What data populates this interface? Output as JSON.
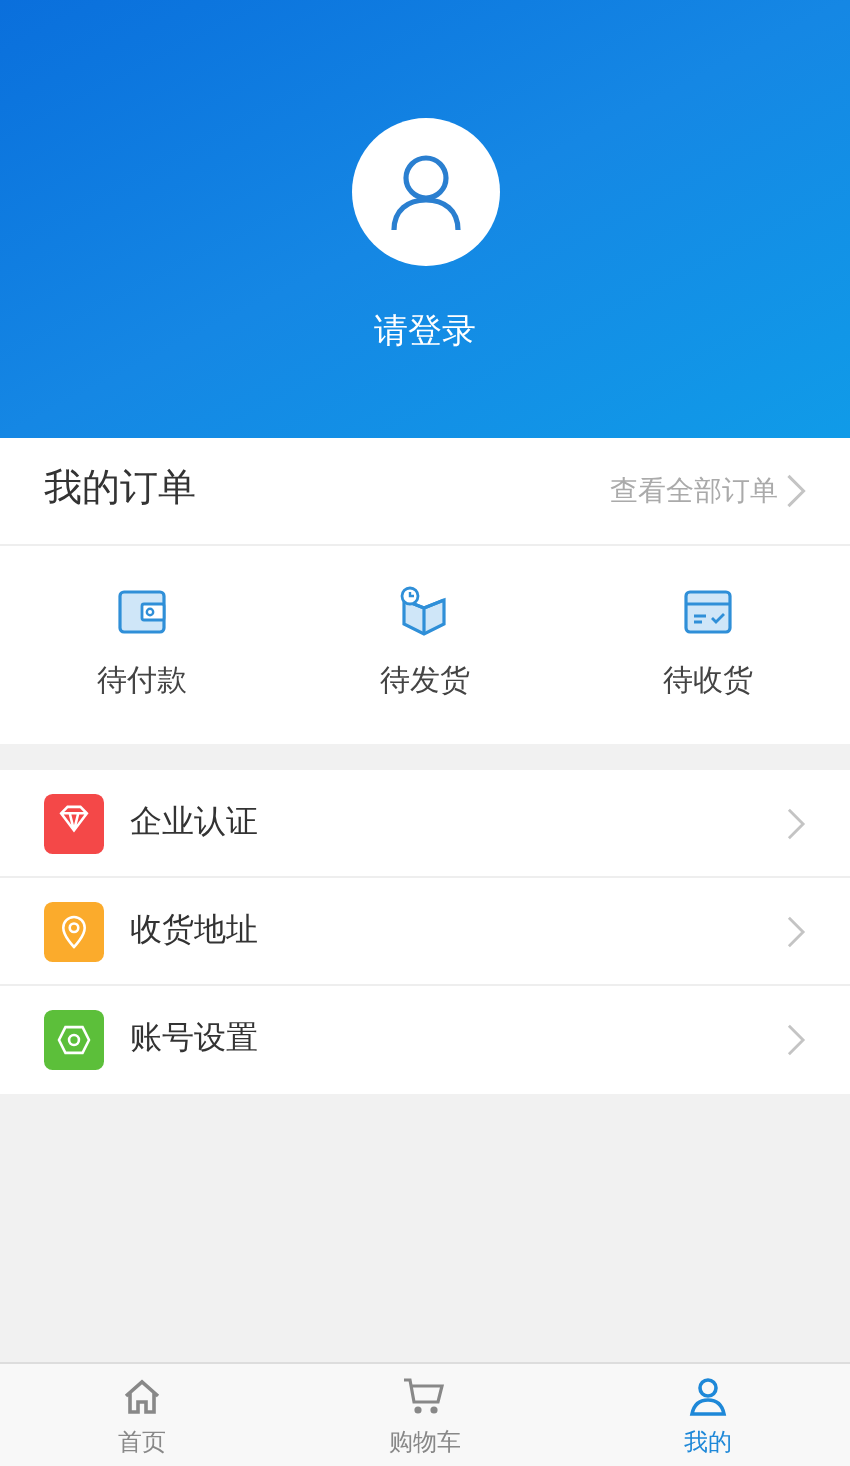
{
  "header": {
    "login": "请登录"
  },
  "orders": {
    "title": "我的订单",
    "view_all": "查看全部订单",
    "items": [
      {
        "kind": "wallet",
        "label": "待付款"
      },
      {
        "kind": "box",
        "label": "待发货"
      },
      {
        "kind": "inbox",
        "label": "待收货"
      }
    ]
  },
  "menu": [
    {
      "kind": "diamond",
      "label": "企业认证",
      "color": "#f44848"
    },
    {
      "kind": "pin",
      "label": "收货地址",
      "color": "#fbab2c"
    },
    {
      "kind": "gear",
      "label": "账号设置",
      "color": "#5cbf3a"
    }
  ],
  "tabs": [
    {
      "kind": "home",
      "label": "首页",
      "selected": false
    },
    {
      "kind": "cart",
      "label": "购物车",
      "selected": false
    },
    {
      "kind": "user",
      "label": "我的",
      "selected": true
    }
  ]
}
